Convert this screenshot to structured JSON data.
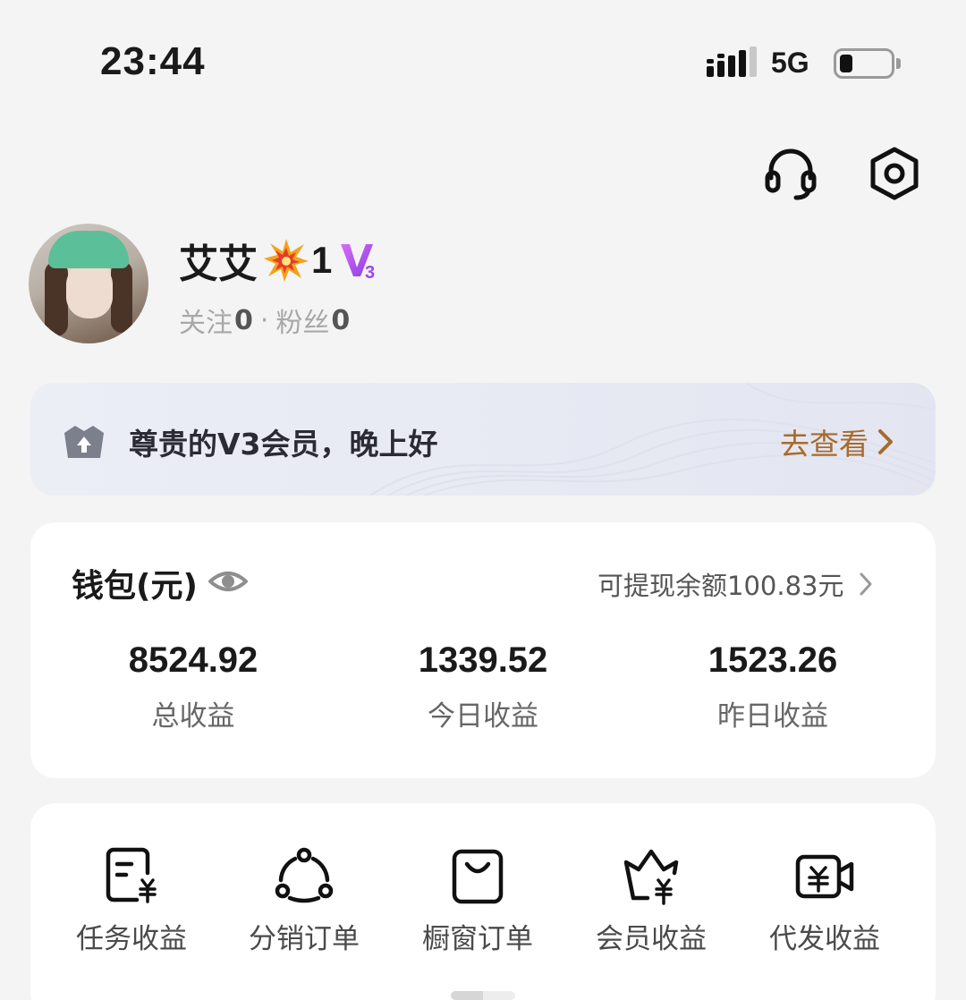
{
  "status_bar": {
    "time": "23:44",
    "network": "5G",
    "signal_icon": "cellular-signal-icon",
    "battery_icon": "battery-icon",
    "battery_level": 0.25
  },
  "header": {
    "support_icon": "headset-icon",
    "settings_icon": "settings-hexagon-icon"
  },
  "profile": {
    "name": "艾艾",
    "badge_icon": "burst-emoji-icon",
    "level": "1",
    "vip_badge": "V3",
    "following_label": "关注",
    "following_count": "0",
    "separator": "·",
    "fans_label": "粉丝",
    "fans_count": "0"
  },
  "member_banner": {
    "icon": "crown-upgrade-icon",
    "greeting": "尊贵的V3会员，晚上好",
    "link_label": "去查看"
  },
  "wallet": {
    "title": "钱包(元)",
    "eye_icon": "eye-icon",
    "withdrawable": "可提现余额100.83元",
    "stats": [
      {
        "value": "8524.92",
        "label": "总收益"
      },
      {
        "value": "1339.52",
        "label": "今日收益"
      },
      {
        "value": "1523.26",
        "label": "昨日收益"
      }
    ]
  },
  "menu": {
    "items": [
      {
        "label": "任务收益",
        "icon": "task-income-icon"
      },
      {
        "label": "分销订单",
        "icon": "distribution-icon"
      },
      {
        "label": "橱窗订单",
        "icon": "shopping-bag-icon"
      },
      {
        "label": "会员收益",
        "icon": "member-crown-income-icon"
      },
      {
        "label": "代发收益",
        "icon": "video-income-icon"
      }
    ]
  },
  "colors": {
    "background": "#f4f4f4",
    "card": "#ffffff",
    "accent_link": "#a76a2c",
    "vip_purple": "#b44cf0",
    "muted_text": "#a8a8a8"
  }
}
